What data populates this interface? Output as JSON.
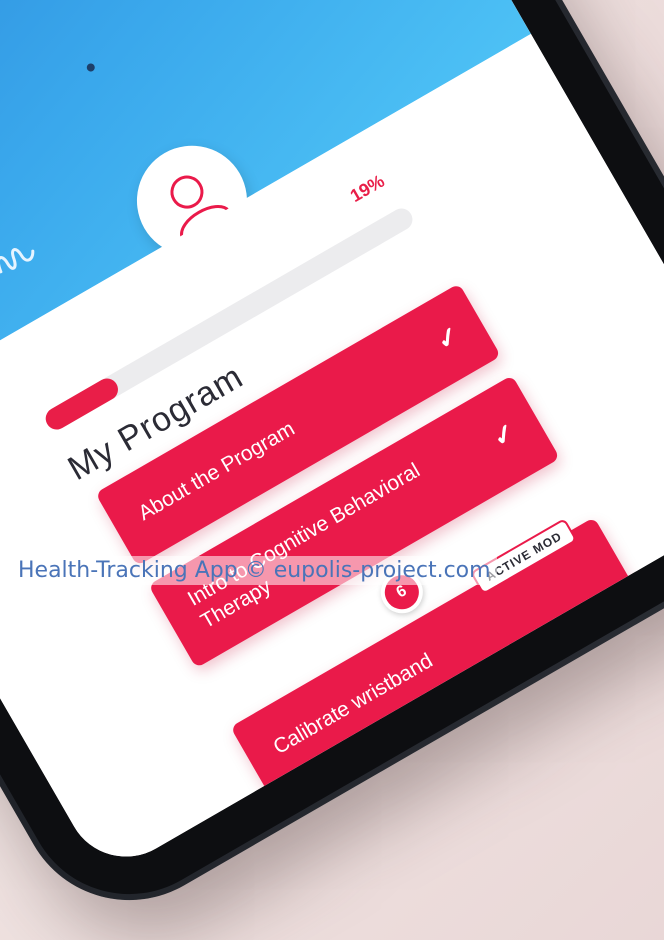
{
  "app": {
    "program_title": "My Program",
    "progress_percent_label": "19%",
    "progress_value": 0.19
  },
  "program_items": [
    {
      "label": "About the Program",
      "completed": true
    },
    {
      "label": "Intro to Cognitive Behavioral Therapy",
      "completed": true
    },
    {
      "label": "Calibrate wristband",
      "completed": false,
      "step": "6"
    }
  ],
  "badges": {
    "active_mode": "ACTIVE MOD"
  },
  "icons": {
    "logo": "squiggle-logo-icon",
    "avatar": "user-avatar-icon",
    "check": "checkmark-icon"
  },
  "caption": "Health-Tracking App © eupolis-project.com",
  "colors": {
    "accent": "#e91e48",
    "header_blue": "#2a86d9",
    "background": "#f1e6e4"
  }
}
